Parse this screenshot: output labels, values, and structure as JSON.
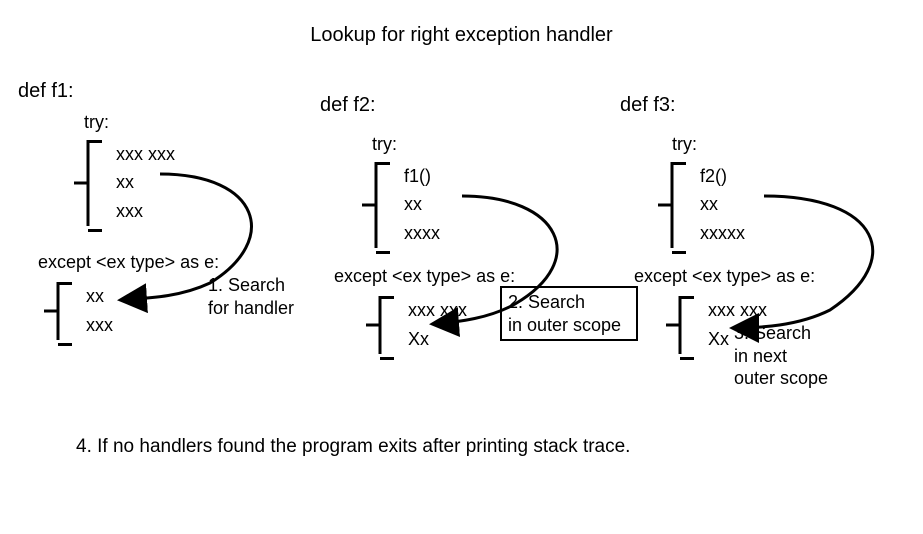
{
  "title": "Lookup for right exception handler",
  "functions": {
    "f1": {
      "def": "def f1:",
      "try_kw": "try:",
      "try_body": [
        "xxx xxx",
        "xx",
        "xxx"
      ],
      "except_line": "except <ex type> as e:",
      "except_body": [
        "xx",
        "xxx"
      ]
    },
    "f2": {
      "def": "def f2:",
      "try_kw": "try:",
      "try_body": [
        "f1()",
        "xx",
        "xxxx"
      ],
      "except_line": "except <ex type> as e:",
      "except_body": [
        "xxx xxx",
        "Xx"
      ]
    },
    "f3": {
      "def": "def f3:",
      "try_kw": "try:",
      "try_body": [
        "f2()",
        "xx",
        "xxxxx"
      ],
      "except_line": "except <ex type> as e:",
      "except_body": [
        "xxx xxx",
        "Xx"
      ]
    }
  },
  "annotations": {
    "step1": "1. Search for handler",
    "step2": "2. Search in outer scope",
    "step3": "3. Search in next outer scope"
  },
  "footnote": "4. If no handlers found the program exits after printing stack trace."
}
